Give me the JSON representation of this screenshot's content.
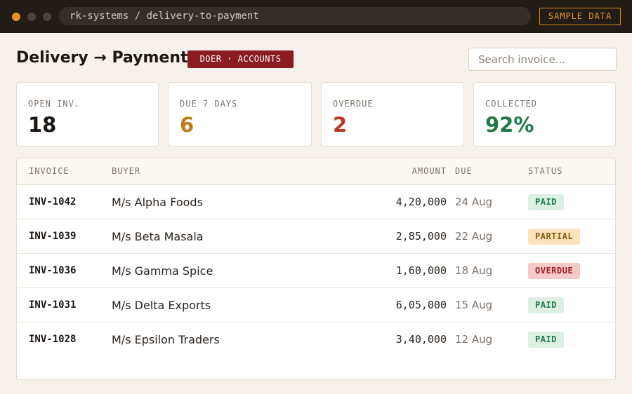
{
  "window": {
    "url": "rk-systems / delivery-to-payment",
    "sample_badge": "SAMPLE DATA"
  },
  "header": {
    "title": "Delivery → Payment",
    "role_badge": "DOER · ACCOUNTS",
    "search_placeholder": "Search invoice..."
  },
  "kpis": [
    {
      "label": "OPEN INV.",
      "value": "18",
      "color": "#1d1714"
    },
    {
      "label": "DUE 7 DAYS",
      "value": "6",
      "color": "#c27a18"
    },
    {
      "label": "OVERDUE",
      "value": "2",
      "color": "#c0352b"
    },
    {
      "label": "COLLECTED",
      "value": "92%",
      "color": "#1f7a4a"
    }
  ],
  "table": {
    "columns": [
      "INVOICE",
      "BUYER",
      "AMOUNT",
      "DUE",
      "STATUS"
    ],
    "rows": [
      {
        "invoice": "INV-1042",
        "buyer": "M/s Alpha Foods",
        "amount": "4,20,000",
        "due": "24 Aug",
        "status": "PAID"
      },
      {
        "invoice": "INV-1039",
        "buyer": "M/s Beta Masala",
        "amount": "2,85,000",
        "due": "22 Aug",
        "status": "PARTIAL"
      },
      {
        "invoice": "INV-1036",
        "buyer": "M/s Gamma Spice",
        "amount": "1,60,000",
        "due": "18 Aug",
        "status": "OVERDUE"
      },
      {
        "invoice": "INV-1031",
        "buyer": "M/s Delta Exports",
        "amount": "6,05,000",
        "due": "15 Aug",
        "status": "PAID"
      },
      {
        "invoice": "INV-1028",
        "buyer": "M/s Epsilon Traders",
        "amount": "3,40,000",
        "due": "12 Aug",
        "status": "PAID"
      }
    ]
  },
  "status_colors": {
    "PAID": {
      "bg": "#dcefe3",
      "fg": "#1f7a4a"
    },
    "PARTIAL": {
      "bg": "#fbe3b9",
      "fg": "#8a5a12"
    },
    "OVERDUE": {
      "bg": "#f4c9c6",
      "fg": "#9b1f24"
    }
  }
}
